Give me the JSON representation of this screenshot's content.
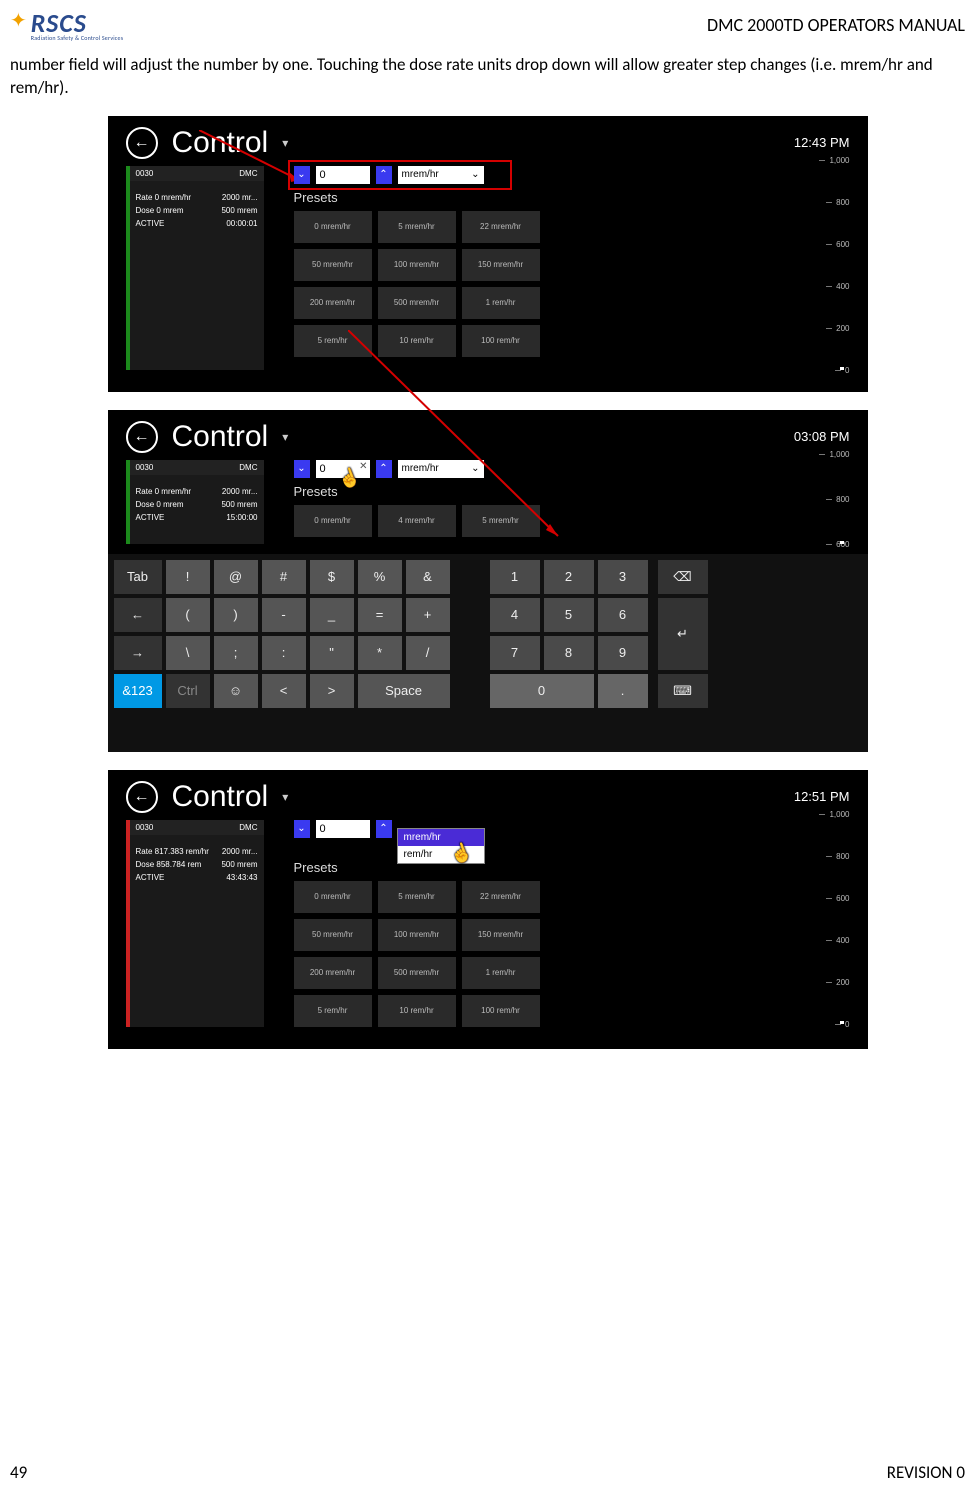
{
  "header": {
    "logo_main": "RSCS",
    "logo_sub": "Radiation Safety & Control Services",
    "doc_title": "DMC 2000TD OPERATORS MANUAL"
  },
  "body_para": "number field will adjust the number by one. Touching the dose rate units drop down will allow greater step changes (i.e. mrem/hr and rem/hr).",
  "footer": {
    "page": "49",
    "rev": "REVISION 0"
  },
  "shot1": {
    "title": "Control",
    "clock": "12:43 PM",
    "device": {
      "id": "0030",
      "model": "DMC",
      "rate_label": "Rate 0 mrem/hr",
      "rate_limit": "2000 mr...",
      "dose_label": "Dose 0 mrem",
      "dose_limit": "500 mrem",
      "status": "ACTIVE",
      "time": "00:00:01"
    },
    "stepper_value": "0",
    "unit": "mrem/hr",
    "presets_label": "Presets",
    "presets": [
      "0 mrem/hr",
      "5 mrem/hr",
      "22 mrem/hr",
      "50 mrem/hr",
      "100 mrem/hr",
      "150 mrem/hr",
      "200 mrem/hr",
      "500 mrem/hr",
      "1 rem/hr",
      "5 rem/hr",
      "10 rem/hr",
      "100 rem/hr"
    ],
    "axis": [
      "1,000",
      "800",
      "600",
      "400",
      "200",
      "0"
    ]
  },
  "shot2": {
    "title": "Control",
    "clock": "03:08 PM",
    "device": {
      "id": "0030",
      "model": "DMC",
      "rate_label": "Rate 0 mrem/hr",
      "rate_limit": "2000 mr...",
      "dose_label": "Dose 0 mrem",
      "dose_limit": "500 mrem",
      "status": "ACTIVE",
      "time": "15:00:00"
    },
    "stepper_value": "0",
    "unit": "mrem/hr",
    "presets_label": "Presets",
    "presets_row": [
      "0 mrem/hr",
      "4 mrem/hr",
      "5 mrem/hr"
    ],
    "axis": [
      "1,000",
      "800",
      "600"
    ],
    "kb": {
      "r1": [
        "Tab",
        "!",
        "@",
        "#",
        "$",
        "%",
        "&"
      ],
      "r2": [
        "←",
        "(",
        ")",
        "-",
        "_",
        "=",
        "+"
      ],
      "r3": [
        "→",
        "\\",
        ";",
        ":",
        "\"",
        "*",
        "/"
      ],
      "r4": [
        "&123",
        "Ctrl",
        "☺",
        "<",
        ">",
        "Space",
        ""
      ],
      "num": [
        "1",
        "2",
        "3",
        "4",
        "5",
        "6",
        "7",
        "8",
        "9",
        "0",
        "."
      ],
      "ctl": [
        "⌫",
        "↵",
        "⌨"
      ]
    }
  },
  "shot3": {
    "title": "Control",
    "clock": "12:51 PM",
    "device": {
      "id": "0030",
      "model": "DMC",
      "rate_label": "Rate 817.383 rem/hr",
      "rate_limit": "2000 mr...",
      "dose_label": "Dose 858.784 rem",
      "dose_limit": "500 mrem",
      "status": "ACTIVE",
      "time": "43:43:43"
    },
    "stepper_value": "0",
    "unit_selected": "mrem/hr",
    "unit_other": "rem/hr",
    "presets_label": "Presets",
    "presets": [
      "0 mrem/hr",
      "5 mrem/hr",
      "22 mrem/hr",
      "50 mrem/hr",
      "100 mrem/hr",
      "150 mrem/hr",
      "200 mrem/hr",
      "500 mrem/hr",
      "1 rem/hr",
      "5 rem/hr",
      "10 rem/hr",
      "100 rem/hr"
    ],
    "axis": [
      "1,000",
      "800",
      "600",
      "400",
      "200",
      "0"
    ]
  }
}
